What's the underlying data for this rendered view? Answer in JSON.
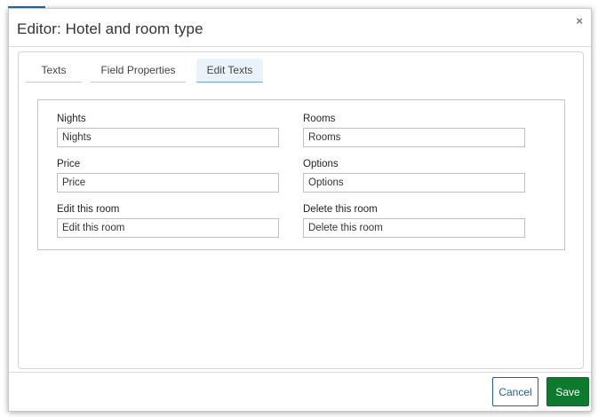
{
  "dialog": {
    "title": "Editor: Hotel and room type",
    "close_glyph": "×"
  },
  "tabs": [
    {
      "label": "Texts",
      "active": false
    },
    {
      "label": "Field Properties",
      "active": false
    },
    {
      "label": "Edit Texts",
      "active": true
    }
  ],
  "fields": {
    "nights": {
      "label": "Nights",
      "value": "Nights"
    },
    "rooms": {
      "label": "Rooms",
      "value": "Rooms"
    },
    "price": {
      "label": "Price",
      "value": "Price"
    },
    "options": {
      "label": "Options",
      "value": "Options"
    },
    "edit_room": {
      "label": "Edit this room",
      "value": "Edit this room"
    },
    "delete_room": {
      "label": "Delete this room",
      "value": "Delete this room"
    }
  },
  "footer": {
    "cancel_label": "Cancel",
    "save_label": "Save"
  },
  "colors": {
    "accent": "#1f6fb2",
    "save_button": "#0e7a2e",
    "cancel_border": "#2a5f8a",
    "active_tab_bg": "#eaf3fb"
  }
}
